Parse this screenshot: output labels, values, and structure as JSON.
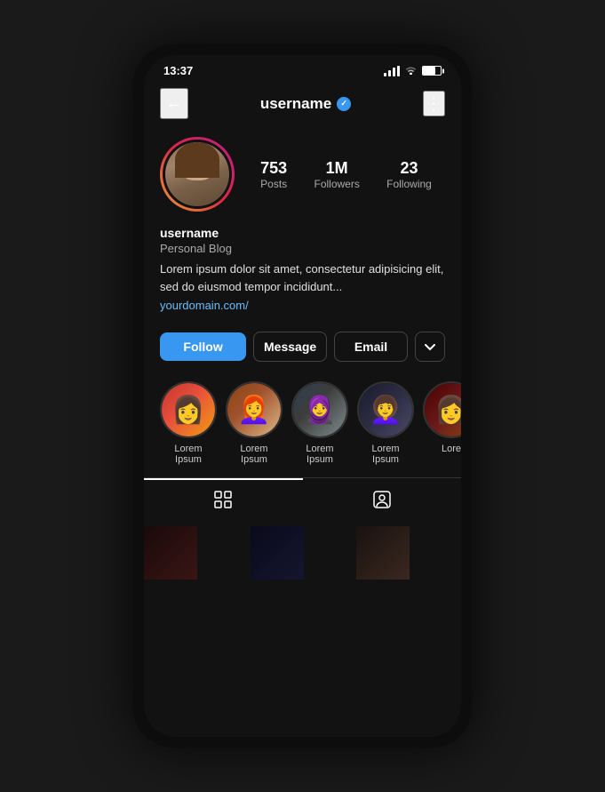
{
  "statusBar": {
    "time": "13:37"
  },
  "header": {
    "backLabel": "←",
    "username": "username",
    "moreLabel": "⋮"
  },
  "profile": {
    "stats": {
      "posts": {
        "value": "753",
        "label": "Posts"
      },
      "followers": {
        "value": "1M",
        "label": "Followers"
      },
      "following": {
        "value": "23",
        "label": "Following"
      }
    },
    "username": "username",
    "category": "Personal Blog",
    "bio": "Lorem ipsum dolor sit amet, consectetur adipisicing elit, sed do eiusmod tempor incididunt...",
    "link": "yourdomain.com/"
  },
  "actions": {
    "follow": "Follow",
    "message": "Message",
    "email": "Email",
    "chevron": "∨"
  },
  "stories": [
    {
      "label": "Lorem Ipsum",
      "personClass": "person-1",
      "emoji": "👩"
    },
    {
      "label": "Lorem Ipsum",
      "personClass": "person-2",
      "emoji": "👩‍🦰"
    },
    {
      "label": "Lorem Ipsum",
      "personClass": "person-3",
      "emoji": "🧕"
    },
    {
      "label": "Lorem Ipsum",
      "personClass": "person-4",
      "emoji": "👩‍🦱"
    },
    {
      "label": "Lore",
      "personClass": "person-5",
      "emoji": "👩"
    }
  ],
  "tabs": {
    "grid": "⊞",
    "tagged": "👤"
  }
}
